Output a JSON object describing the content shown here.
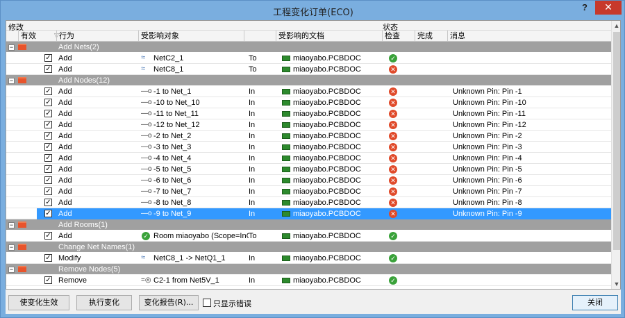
{
  "window": {
    "title": "工程变化订单(ECO)",
    "help_label": "?",
    "close_label": "✕"
  },
  "header": {
    "group_modify": "修改",
    "group_status": "状态",
    "columns": {
      "enabled": "有效",
      "action": "行为",
      "object": "受影响对象",
      "document": "受影响的文档",
      "check": "检查",
      "done": "完成",
      "message": "消息"
    }
  },
  "rows": [
    {
      "type": "group",
      "label": "Add Nets(2)"
    },
    {
      "type": "item",
      "checked": true,
      "action": "Add",
      "icon": "net-icon",
      "object": "NetC2_1",
      "rel": "To",
      "document": "miaoyabo.PCBDOC",
      "status": "ok",
      "message": ""
    },
    {
      "type": "item",
      "checked": true,
      "action": "Add",
      "icon": "net-icon",
      "object": "NetC8_1",
      "rel": "To",
      "document": "miaoyabo.PCBDOC",
      "status": "error",
      "message": ""
    },
    {
      "type": "group",
      "label": "Add Nodes(12)"
    },
    {
      "type": "item",
      "checked": true,
      "action": "Add",
      "icon": "node-icon",
      "object": "-1 to Net_1",
      "rel": "In",
      "document": "miaoyabo.PCBDOC",
      "status": "error",
      "message": "Unknown Pin: Pin -1"
    },
    {
      "type": "item",
      "checked": true,
      "action": "Add",
      "icon": "node-icon",
      "object": "-10 to Net_10",
      "rel": "In",
      "document": "miaoyabo.PCBDOC",
      "status": "error",
      "message": "Unknown Pin: Pin -10"
    },
    {
      "type": "item",
      "checked": true,
      "action": "Add",
      "icon": "node-icon",
      "object": "-11 to Net_11",
      "rel": "In",
      "document": "miaoyabo.PCBDOC",
      "status": "error",
      "message": "Unknown Pin: Pin -11"
    },
    {
      "type": "item",
      "checked": true,
      "action": "Add",
      "icon": "node-icon",
      "object": "-12 to Net_12",
      "rel": "In",
      "document": "miaoyabo.PCBDOC",
      "status": "error",
      "message": "Unknown Pin: Pin -12"
    },
    {
      "type": "item",
      "checked": true,
      "action": "Add",
      "icon": "node-icon",
      "object": "-2 to Net_2",
      "rel": "In",
      "document": "miaoyabo.PCBDOC",
      "status": "error",
      "message": "Unknown Pin: Pin -2"
    },
    {
      "type": "item",
      "checked": true,
      "action": "Add",
      "icon": "node-icon",
      "object": "-3 to Net_3",
      "rel": "In",
      "document": "miaoyabo.PCBDOC",
      "status": "error",
      "message": "Unknown Pin: Pin -3"
    },
    {
      "type": "item",
      "checked": true,
      "action": "Add",
      "icon": "node-icon",
      "object": "-4 to Net_4",
      "rel": "In",
      "document": "miaoyabo.PCBDOC",
      "status": "error",
      "message": "Unknown Pin: Pin -4"
    },
    {
      "type": "item",
      "checked": true,
      "action": "Add",
      "icon": "node-icon",
      "object": "-5 to Net_5",
      "rel": "In",
      "document": "miaoyabo.PCBDOC",
      "status": "error",
      "message": "Unknown Pin: Pin -5"
    },
    {
      "type": "item",
      "checked": true,
      "action": "Add",
      "icon": "node-icon",
      "object": "-6 to Net_6",
      "rel": "In",
      "document": "miaoyabo.PCBDOC",
      "status": "error",
      "message": "Unknown Pin: Pin -6"
    },
    {
      "type": "item",
      "checked": true,
      "action": "Add",
      "icon": "node-icon",
      "object": "-7 to Net_7",
      "rel": "In",
      "document": "miaoyabo.PCBDOC",
      "status": "error",
      "message": "Unknown Pin: Pin -7"
    },
    {
      "type": "item",
      "checked": true,
      "action": "Add",
      "icon": "node-icon",
      "object": "-8 to Net_8",
      "rel": "In",
      "document": "miaoyabo.PCBDOC",
      "status": "error",
      "message": "Unknown Pin: Pin -8"
    },
    {
      "type": "item",
      "checked": true,
      "selected": true,
      "action": "Add",
      "icon": "node-icon",
      "object": "-9 to Net_9",
      "rel": "In",
      "document": "miaoyabo.PCBDOC",
      "status": "error",
      "message": "Unknown Pin: Pin -9"
    },
    {
      "type": "group",
      "label": "Add Rooms(1)"
    },
    {
      "type": "item",
      "checked": true,
      "action": "Add",
      "icon": "room-icon",
      "object": "Room miaoyabo (Scope=InComp",
      "rel": "To",
      "document": "miaoyabo.PCBDOC",
      "status": "ok",
      "message": ""
    },
    {
      "type": "group",
      "label": "Change Net Names(1)"
    },
    {
      "type": "item",
      "checked": true,
      "action": "Modify",
      "icon": "net-icon",
      "object": "NetC8_1 -> NetQ1_1",
      "rel": "In",
      "document": "miaoyabo.PCBDOC",
      "status": "ok",
      "message": ""
    },
    {
      "type": "group",
      "label": "Remove Nodes(5)"
    },
    {
      "type": "item",
      "checked": true,
      "action": "Remove",
      "icon": "remove-node-icon",
      "object": "C2-1 from Net5V_1",
      "rel": "In",
      "document": "miaoyabo.PCBDOC",
      "status": "ok",
      "message": ""
    }
  ],
  "buttons": {
    "validate": "使变化生效",
    "execute": "执行变化",
    "report": "变化报告(R)...",
    "only_errors": "只显示错误",
    "close": "关闭"
  },
  "colors": {
    "group_row": "#a0a0a0",
    "selection": "#3399ff",
    "ok": "#3aa23a",
    "error": "#e04a2a",
    "folder": "#e8542c",
    "close_titlebar": "#c7392b"
  }
}
